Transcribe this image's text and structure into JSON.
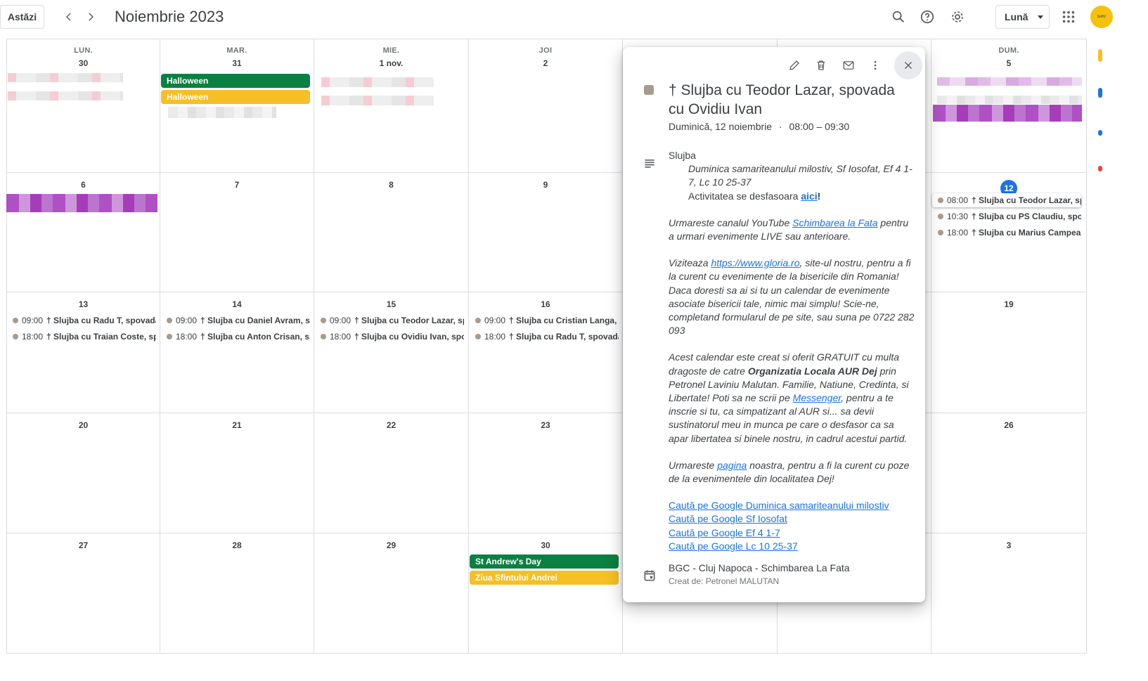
{
  "header": {
    "today_label": "Astăzi",
    "month_title": "Noiembrie 2023",
    "view_label": "Lună",
    "avatar_text": "SoftV"
  },
  "weekdays": [
    "LUN.",
    "MAR.",
    "MIE.",
    "JOI",
    "",
    "",
    "DUM."
  ],
  "weeks": [
    [
      "30",
      "31",
      "1 nov.",
      "2",
      "",
      "",
      "5"
    ],
    [
      "6",
      "7",
      "8",
      "9",
      "",
      "",
      "12"
    ],
    [
      "13",
      "14",
      "15",
      "16",
      "",
      "",
      "19"
    ],
    [
      "20",
      "21",
      "22",
      "23",
      "",
      "",
      "26"
    ],
    [
      "27",
      "28",
      "29",
      "30",
      "",
      "",
      "3"
    ]
  ],
  "allday_events": {
    "halloween_1": "Halloween",
    "halloween_2": "Halloween",
    "st_andrew": "St Andrew's Day",
    "ziua_andrei": "Ziua Sfintului Andrei"
  },
  "events": {
    "sun12": [
      {
        "time": "08:00",
        "title": "† Slujba cu Teodor Lazar, spov"
      },
      {
        "time": "10:30",
        "title": "† Slujba cu PS Claudiu, spovad"
      },
      {
        "time": "18:00",
        "title": "† Slujba cu Marius Campean, s"
      }
    ],
    "mon13": [
      {
        "time": "09:00",
        "title": "† Slujba cu Radu T, spovada cu"
      },
      {
        "time": "18:00",
        "title": "† Slujba cu Traian Coste, spov"
      }
    ],
    "tue14": [
      {
        "time": "09:00",
        "title": "† Slujba cu Daniel Avram, spov"
      },
      {
        "time": "18:00",
        "title": "† Slujba cu Anton Crisan, spov"
      }
    ],
    "wed15": [
      {
        "time": "09:00",
        "title": "† Slujba cu Teodor Lazar, spov"
      },
      {
        "time": "18:00",
        "title": "† Slujba cu Ovidiu Ivan, spovad"
      }
    ],
    "thu16": [
      {
        "time": "09:00",
        "title": "† Slujba cu Cristian Langa, spo"
      },
      {
        "time": "18:00",
        "title": "† Slujba cu Radu T, spovada cu"
      }
    ]
  },
  "popup": {
    "title": "† Slujba cu Teodor Lazar, spovada cu Ovidiu Ivan",
    "date": "Duminică, 12 noiembrie",
    "time": "08:00 – 09:30",
    "desc": {
      "line1": "Slujba",
      "line2": "Duminica samariteanului milostiv, Sf Iosofat, Ef 4 1-7, Lc 10 25-37",
      "line3a": "Activitatea se desfasoara ",
      "line3_link": "aici",
      "line3b": "!",
      "p2a": "Urmareste canalul YouTube ",
      "p2_link": "Schimbarea la Fata",
      "p2b": " pentru a urmari evenimente LIVE sau anterioare.",
      "p3a": "Viziteaza ",
      "p3_link": "https://www.gloria.ro",
      "p3b": ", site-ul nostru, pentru a fi la curent cu evenimente de la bisericile din Romania! Daca doresti sa ai si tu un calendar de evenimente asociate bisericii tale, nimic mai simplu! Scie-ne, completand formularul de pe site, sau suna pe 0722 282 093",
      "p4a": "Acest calendar este creat si oferit GRATUIT cu multa dragoste de catre ",
      "p4_bold": "Organizatia Locala AUR Dej",
      "p4b": " prin Petronel Laviniu Malutan. Familie, Natiune, Credinta, si Libertate! Poti sa ne scrii pe ",
      "p4_link": "Messenger",
      "p4c": ", pentru a te inscrie si tu, ca simpatizant al AUR si... sa devii sustinatorul meu in munca pe care o desfasor ca sa apar libertatea si binele nostru, in cadrul acestui partid.",
      "p5a": "Urmareste  ",
      "p5_link": "pagina",
      "p5b": " noastra, pentru a fi la curent cu poze de la evenimentele din localitatea Dej!",
      "search1": "Caută pe Google Duminica samariteanului milostiv",
      "search2": "Caută pe Google Sf Iosofat",
      "search3": "Caută pe Google Ef 4 1-7",
      "search4": "Caută pe Google Lc 10 25-37"
    },
    "calendar_name": "BGC - Cluj Napoca - Schimbarea La Fata",
    "creator": "Creat de: Petronel MALUTAN"
  },
  "colors": {
    "green": "#0b8043",
    "yellow": "#f6bf26",
    "today": "#1a73e8",
    "event_dot": "#a79b8e"
  }
}
